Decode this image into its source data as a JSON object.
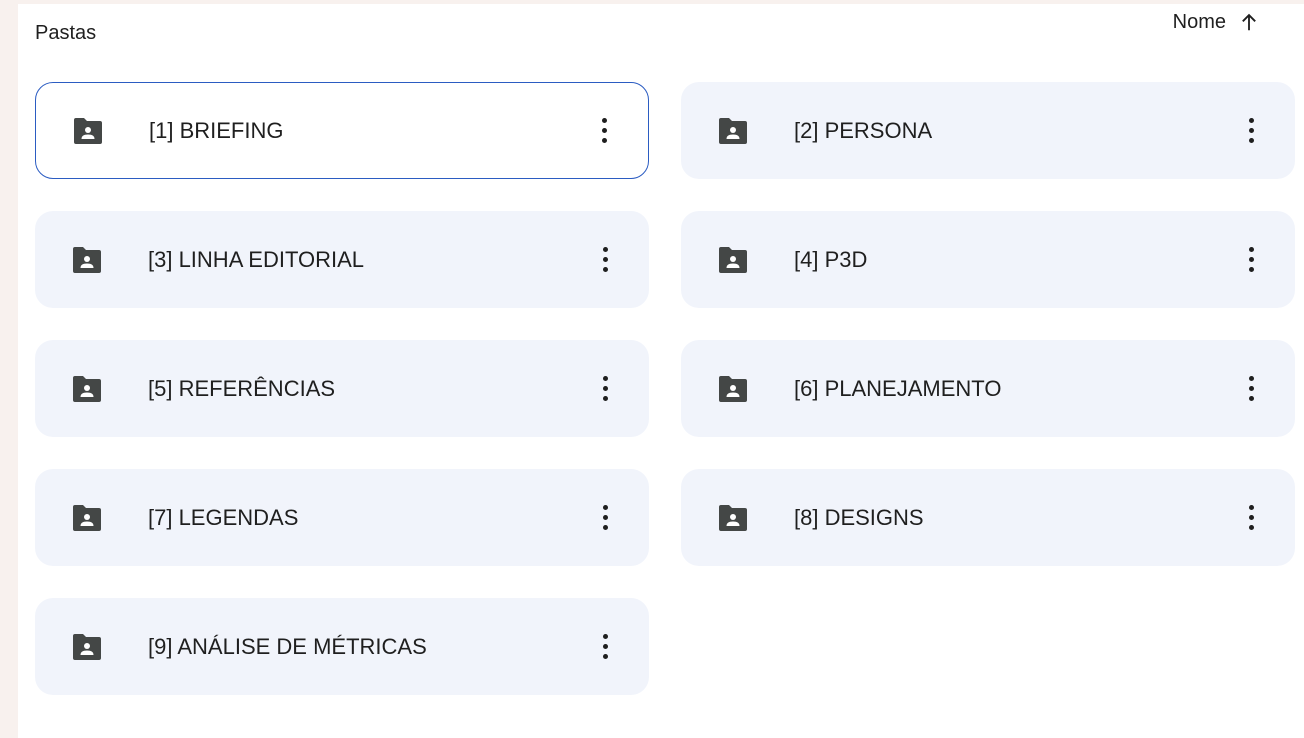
{
  "section": {
    "title": "Pastas"
  },
  "sort": {
    "label": "Nome",
    "direction_icon": "arrow-up-icon"
  },
  "folders": [
    {
      "label": "[1] BRIEFING",
      "selected": true,
      "icon": "shared-folder-icon"
    },
    {
      "label": "[2] PERSONA",
      "selected": false,
      "icon": "shared-folder-icon"
    },
    {
      "label": "[3] LINHA EDITORIAL",
      "selected": false,
      "icon": "shared-folder-icon"
    },
    {
      "label": "[4] P3D",
      "selected": false,
      "icon": "shared-folder-icon"
    },
    {
      "label": "[5] REFERÊNCIAS",
      "selected": false,
      "icon": "shared-folder-icon"
    },
    {
      "label": "[6] PLANEJAMENTO",
      "selected": false,
      "icon": "shared-folder-icon"
    },
    {
      "label": "[7] LEGENDAS",
      "selected": false,
      "icon": "shared-folder-icon"
    },
    {
      "label": "[8] DESIGNS",
      "selected": false,
      "icon": "shared-folder-icon"
    },
    {
      "label": "[9] ANÁLISE DE MÉTRICAS",
      "selected": false,
      "icon": "shared-folder-icon"
    }
  ],
  "colors": {
    "card_bg": "#f1f4fb",
    "selected_border": "#2b5cc2",
    "icon": "#444746",
    "text": "#1f1f1f"
  }
}
